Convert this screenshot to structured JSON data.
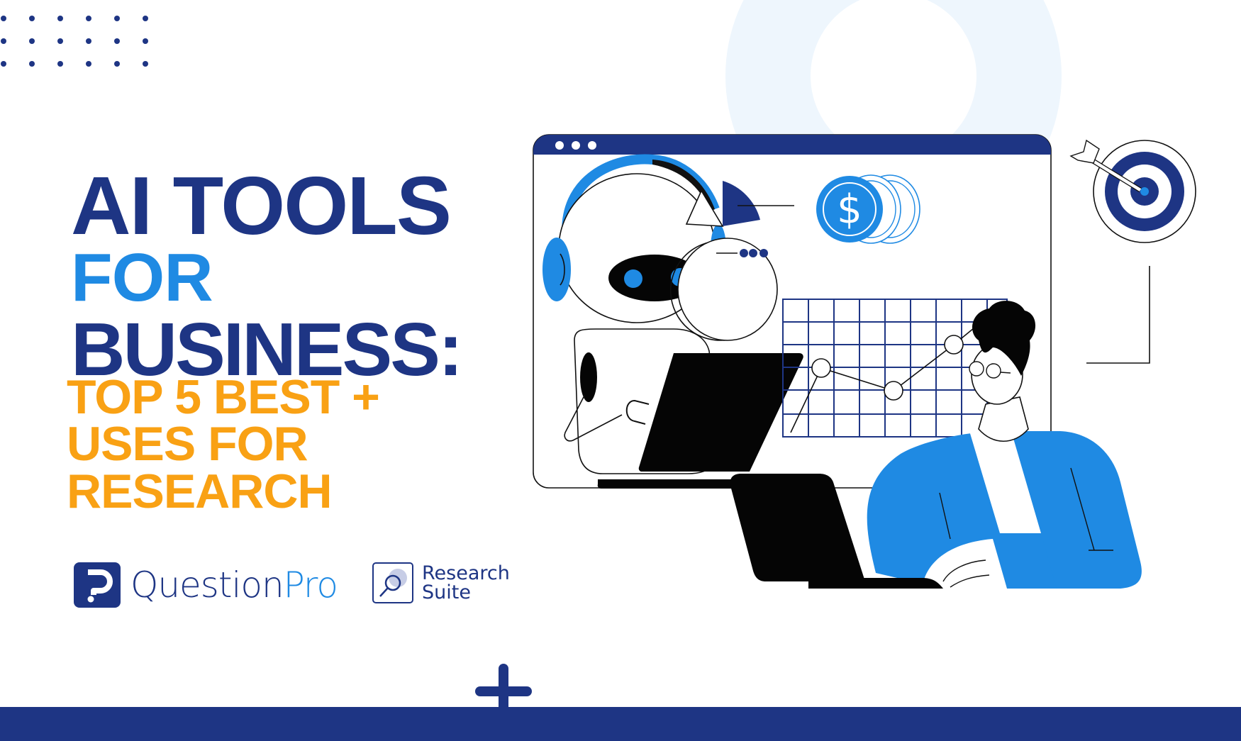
{
  "headline": {
    "line1": "AI TOOLS",
    "line2": "FOR",
    "line3": "BUSINESS:"
  },
  "subheadline": {
    "line1": "TOP 5 BEST +",
    "line2": "USES FOR",
    "line3": "RESEARCH"
  },
  "logos": {
    "questionpro": {
      "name_part1": "Question",
      "name_part2": "Pro"
    },
    "research_suite": {
      "line1": "Research",
      "line2": "Suite"
    }
  },
  "illustration": {
    "coin_symbol": "$"
  },
  "colors": {
    "navy": "#1e3584",
    "blue": "#1f8ae3",
    "orange": "#f9a114",
    "ring": "#eef6fd"
  }
}
